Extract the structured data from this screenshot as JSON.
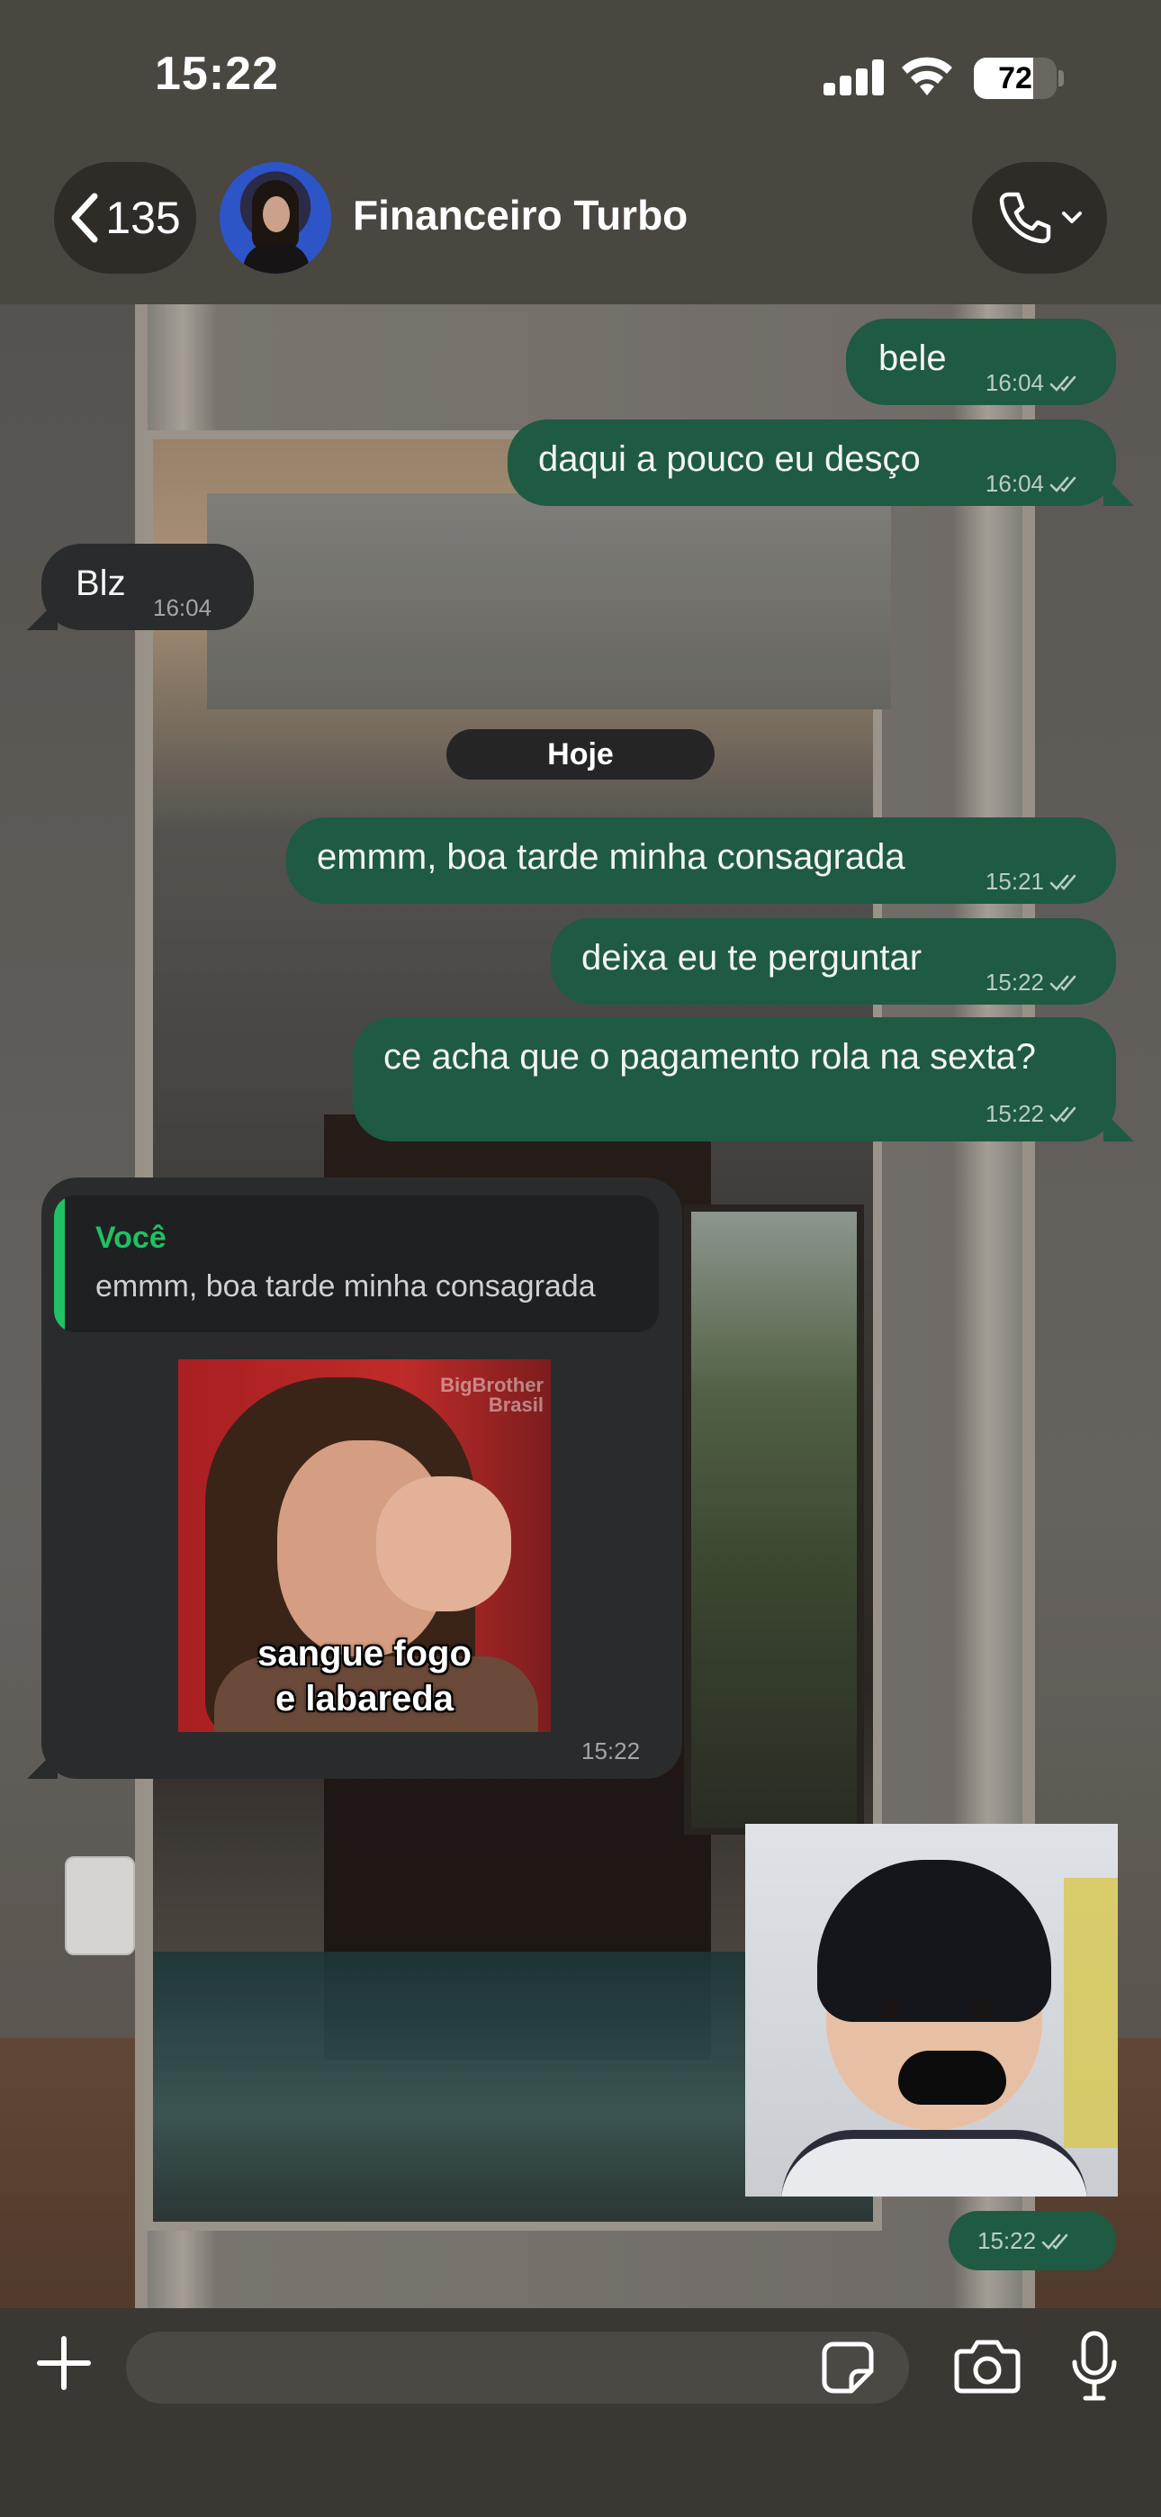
{
  "status_bar": {
    "time": "15:22",
    "battery": "72",
    "battery_level": 0.72
  },
  "header": {
    "back_count": "135",
    "title": "Financeiro Turbo"
  },
  "messages": [
    {
      "text": "bele",
      "time": "16:04"
    },
    {
      "text": "daqui a pouco eu desço",
      "time": "16:04"
    },
    {
      "text": "Blz",
      "time": "16:04"
    },
    {
      "text": "emmm, boa tarde minha consagrada",
      "time": "15:21"
    },
    {
      "text": "deixa eu te perguntar",
      "time": "15:22"
    },
    {
      "text": "ce acha que o pagamento rola na sexta?",
      "time": "15:22"
    }
  ],
  "date_separator": "Hoje",
  "reply_message": {
    "quote_author": "Você",
    "quote_text": "emmm, boa tarde minha consagrada",
    "sticker_caption_1": "sangue fogo",
    "sticker_caption_2": "e labareda",
    "sticker_logo_1": "BigBrother",
    "sticker_logo_2": "Brasil",
    "time": "15:22"
  },
  "sticker_message": {
    "time": "15:22"
  },
  "input": {
    "placeholder": ""
  },
  "icons": {
    "back": "chevron-left-icon",
    "call": "phone-icon",
    "read": "double-check-icon",
    "add": "plus-icon",
    "sticker": "sticker-icon",
    "camera": "camera-icon",
    "mic": "microphone-icon"
  }
}
